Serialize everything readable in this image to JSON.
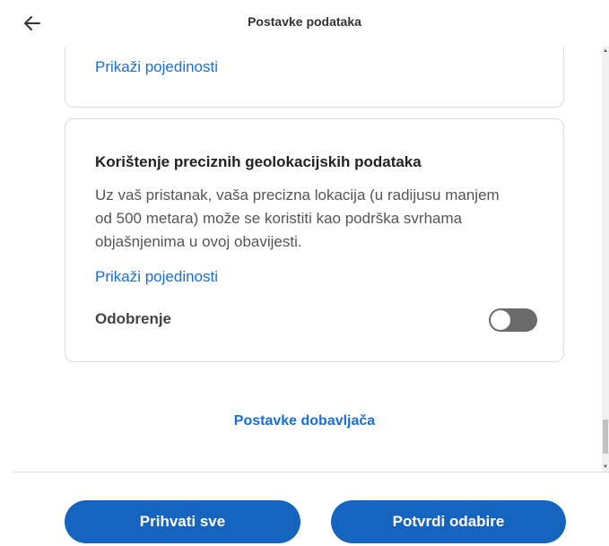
{
  "header": {
    "title": "Postavke podataka",
    "back_icon": "arrow-left-icon"
  },
  "card_top": {
    "details_link": "Prikaži pojedinosti"
  },
  "card_geolocation": {
    "title": "Korištenje preciznih geolokacijskih podataka",
    "description": "Uz vaš pristanak, vaša precizna lokacija (u radijusu manjem od 500 metara) može se koristiti kao podrška svrhama objašnjenima u ovoj obavijesti.",
    "details_link": "Prikaži pojedinosti",
    "consent_label": "Odobrenje",
    "consent_enabled": false
  },
  "vendor_link": "Postavke dobavljača",
  "footer": {
    "accept_all_label": "Prihvati sve",
    "confirm_label": "Potvrdi odabire"
  },
  "colors": {
    "accent": "#1565c0",
    "link": "#1a6ed8",
    "toggle_off": "#6b6b6b"
  }
}
